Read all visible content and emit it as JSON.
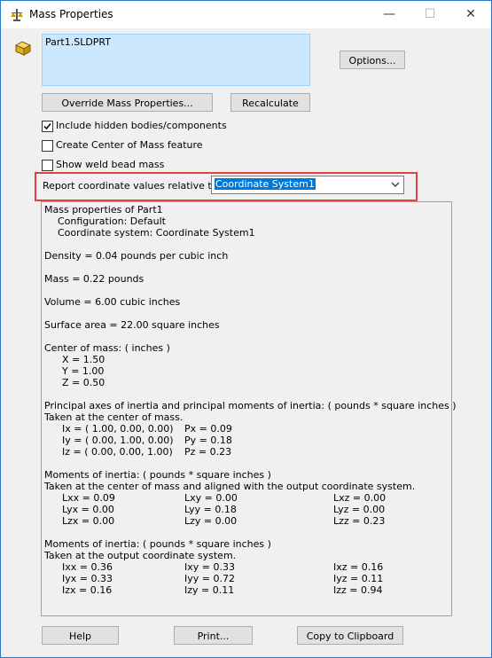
{
  "window": {
    "title": "Mass Properties",
    "minimize": "—",
    "maximize": "☐",
    "close": "✕"
  },
  "part": {
    "name": "Part1.SLDPRT"
  },
  "buttons": {
    "options": "Options...",
    "override": "Override Mass Properties...",
    "recalculate": "Recalculate",
    "help": "Help",
    "print": "Print...",
    "copy": "Copy to Clipboard"
  },
  "checkboxes": [
    {
      "label": "Include hidden bodies/components",
      "checked": true
    },
    {
      "label": "Create Center of Mass feature",
      "checked": false
    },
    {
      "label": "Show weld bead mass",
      "checked": false
    }
  ],
  "report": {
    "label": "Report coordinate values relative to:",
    "selected": "Coordinate System1"
  },
  "results": {
    "header": "Mass properties of Part1",
    "configuration": "Configuration: Default",
    "coord_system": "Coordinate system: Coordinate System1",
    "density": "Density = 0.04 pounds per cubic inch",
    "mass": "Mass = 0.22 pounds",
    "volume": "Volume = 6.00 cubic inches",
    "surface_area": "Surface area = 22.00 square inches",
    "com_title": "Center of mass: ( inches )",
    "com_x": "X = 1.50",
    "com_y": "Y = 1.00",
    "com_z": "Z = 0.50",
    "principal_title": "Principal axes of inertia and principal moments of inertia: ( pounds * square inches )",
    "principal_sub": "Taken at the center of mass.",
    "principal_rows": [
      {
        "axis": "Ix = ( 1.00,  0.00,  0.00)",
        "moment": "Px = 0.09"
      },
      {
        "axis": "Iy = ( 0.00,  1.00,  0.00)",
        "moment": "Py = 0.18"
      },
      {
        "axis": "Iz = ( 0.00,  0.00,  1.00)",
        "moment": "Pz = 0.23"
      }
    ],
    "moi_com_title": "Moments of inertia: ( pounds * square inches )",
    "moi_com_sub": "Taken at the center of mass and aligned with the output coordinate system.",
    "moi_com_rows": [
      [
        "Lxx = 0.09",
        "Lxy = 0.00",
        "Lxz = 0.00"
      ],
      [
        "Lyx = 0.00",
        "Lyy = 0.18",
        "Lyz = 0.00"
      ],
      [
        "Lzx = 0.00",
        "Lzy = 0.00",
        "Lzz = 0.23"
      ]
    ],
    "moi_out_title": "Moments of inertia: ( pounds * square inches )",
    "moi_out_sub": "Taken at the output coordinate system.",
    "moi_out_rows": [
      [
        "Ixx = 0.36",
        "Ixy = 0.33",
        "Ixz = 0.16"
      ],
      [
        "Iyx = 0.33",
        "Iyy = 0.72",
        "Iyz = 0.11"
      ],
      [
        "Izx = 0.16",
        "Izy = 0.11",
        "Izz = 0.94"
      ]
    ]
  },
  "colors": {
    "selection": "#cce8ff",
    "highlight_border": "#e04040",
    "dropdown_selected": "#0078d7"
  }
}
